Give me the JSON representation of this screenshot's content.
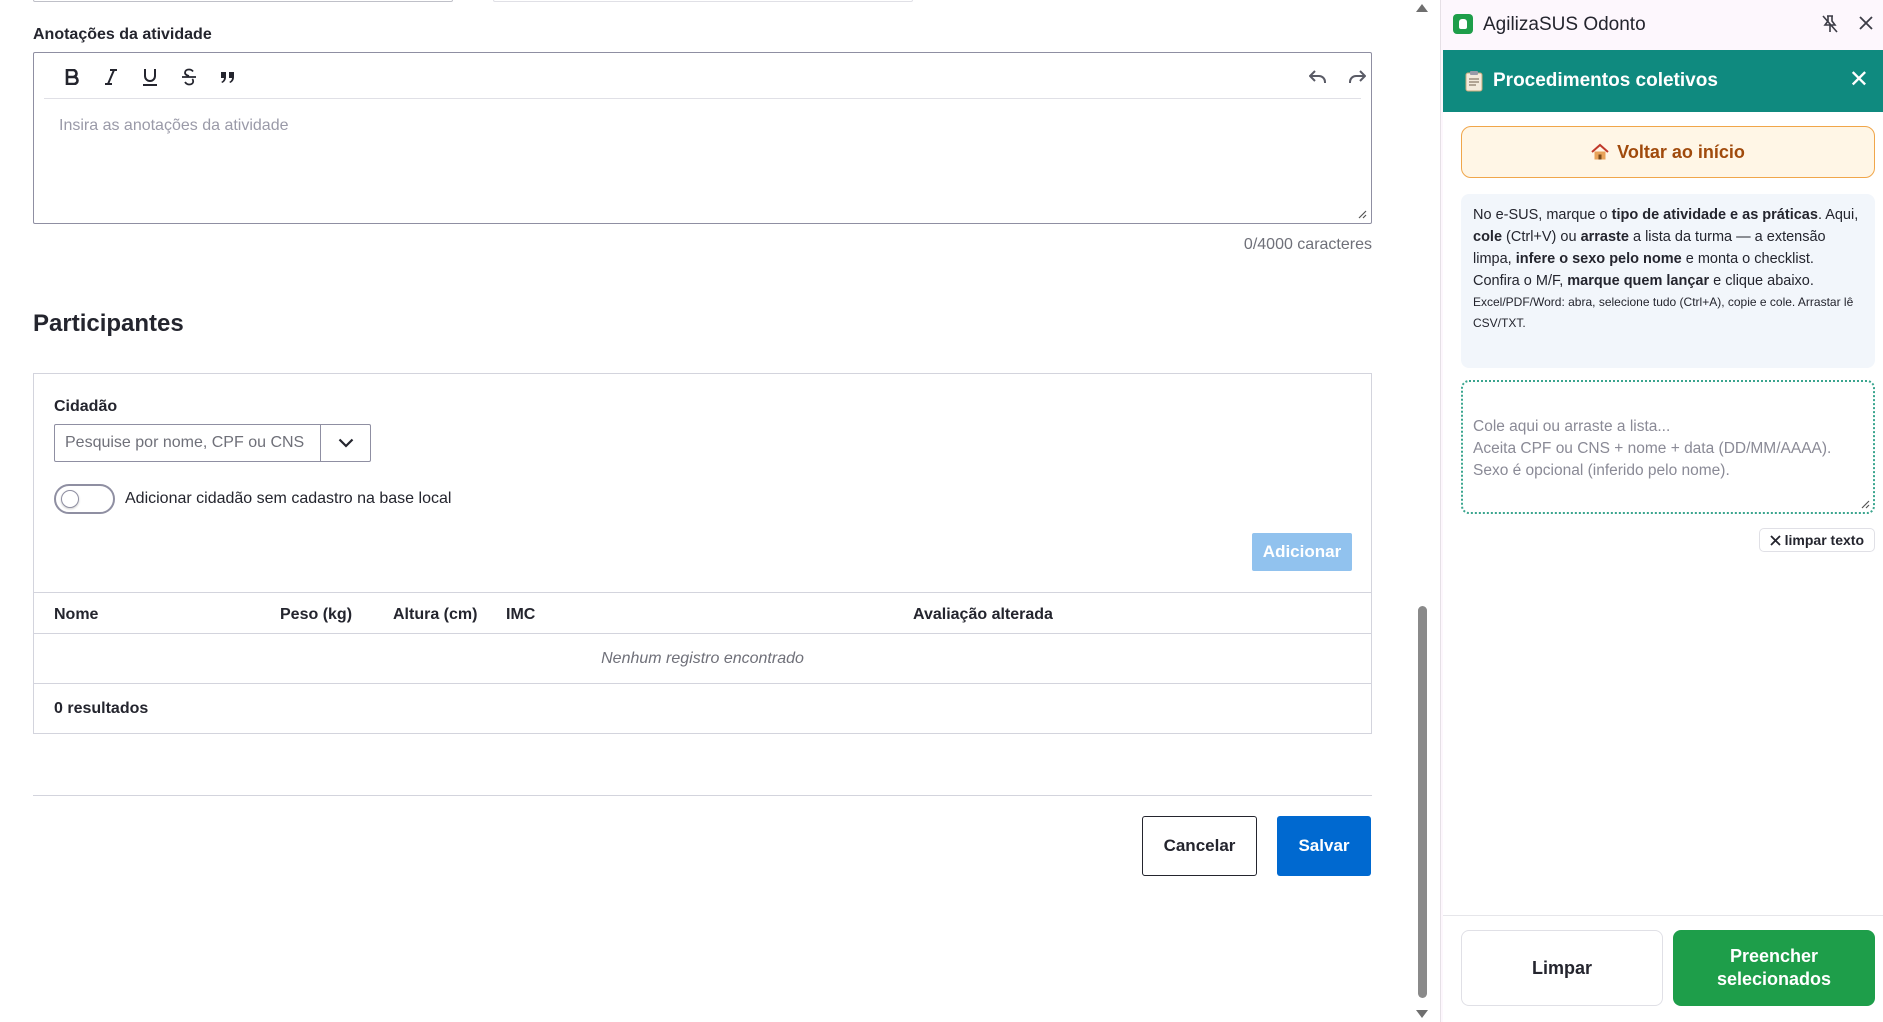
{
  "notes": {
    "label": "Anotações da atividade",
    "placeholder": "Insira as anotações da atividade",
    "char_count": "0/4000 caracteres",
    "toolbar": [
      "bold",
      "italic",
      "underline",
      "strikethrough",
      "quote",
      "undo",
      "redo"
    ]
  },
  "participants": {
    "title": "Participantes",
    "citizen_label": "Cidadão",
    "citizen_placeholder": "Pesquise por nome, CPF ou CNS",
    "toggle_label": "Adicionar cidadão sem cadastro na base local",
    "add_label": "Adicionar",
    "columns": [
      "Nome",
      "Peso (kg)",
      "Altura (cm)",
      "IMC",
      "Avaliação alterada"
    ],
    "empty_text": "Nenhum registro encontrado",
    "results": "0 resultados"
  },
  "actions": {
    "cancel": "Cancelar",
    "save": "Salvar"
  },
  "extension": {
    "app_title": "AgilizaSUS Odonto",
    "panel_title": "Procedimentos coletivos",
    "home_label": "Voltar ao início",
    "info": {
      "p1": "No e-SUS, marque o ",
      "b1": "tipo de atividade e as práticas",
      "p2": ". Aqui, ",
      "b2": "cole",
      "p3": " (Ctrl+V) ou ",
      "b3": "arraste",
      "p4": " a lista da turma — a extensão limpa, ",
      "b4": "infere o sexo pelo nome",
      "p5": " e monta o checklist. Confira o M/F, ",
      "b5": "marque quem lançar",
      "p6": " e clique abaixo.",
      "small": "Excel/PDF/Word: abra, selecione tudo (Ctrl+A), copie e cole. Arrastar lê CSV/TXT."
    },
    "paste_placeholder": "Cole aqui ou arraste a lista...\nAceita CPF ou CNS + nome + data (DD/MM/AAAA).\nSexo é opcional (inferido pelo nome).",
    "clear_text_label": "limpar texto",
    "clear_label": "Limpar",
    "fill_label": "Preencher selecionados"
  },
  "colors": {
    "primary_blue": "#0069d0",
    "disabled_blue": "#91c2ee",
    "teal_header": "#0f8a7f",
    "green": "#1e9e4a",
    "home_orange": "#f0a64a"
  }
}
